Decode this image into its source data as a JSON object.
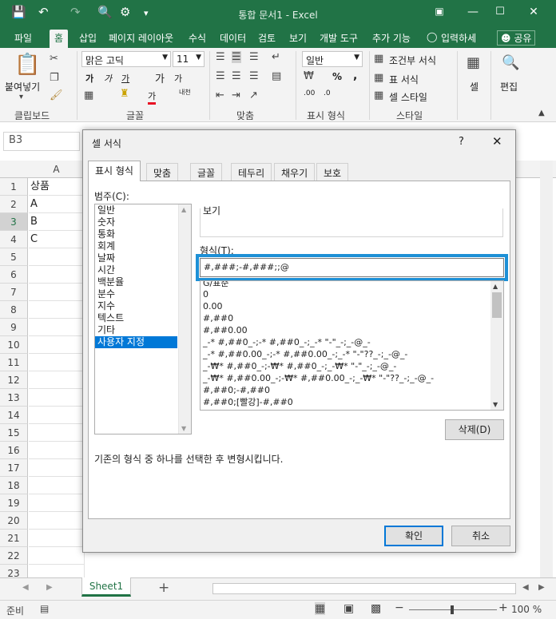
{
  "window": {
    "title": "통합 문서1 - Excel",
    "help_icon": "?",
    "controls": [
      "restore-ribbon-icon",
      "minimize-icon",
      "maximize-icon",
      "close-icon"
    ]
  },
  "quick_access": [
    "save-icon",
    "undo-icon",
    "redo-icon",
    "print-preview-icon",
    "camera-icon",
    "customize-icon"
  ],
  "ribbon": {
    "tabs": [
      "파일",
      "홈",
      "삽입",
      "페이지 레이아웃",
      "수식",
      "데이터",
      "검토",
      "보기",
      "개발 도구",
      "추가 기능"
    ],
    "active_tab": "홈",
    "tell_me": "입력하세",
    "share": "공유",
    "groups": {
      "clipboard": {
        "label": "클립보드",
        "paste": "붙여넣기"
      },
      "font": {
        "label": "글꼴",
        "font_name": "맑은 고딕",
        "font_size": "11",
        "bold": "가",
        "italic": "가",
        "underline": "가",
        "grow": "가",
        "shrink": "가",
        "phonetic": "내천",
        "font_color_glyph": "가"
      },
      "alignment": {
        "label": "맞춤"
      },
      "number": {
        "label": "표시 형식",
        "format": "일반",
        "percent": "%",
        "comma": ",",
        "inc_decimal": ".00",
        "dec_decimal": ".0"
      },
      "styles": {
        "label": "스타일",
        "conditional": "조건부 서식",
        "table": "표 서식",
        "cell_styles": "셀 스타일"
      },
      "cells": {
        "label": "셀"
      },
      "editing": {
        "label": "편집"
      }
    }
  },
  "namebox": "B3",
  "grid": {
    "col_header": "A",
    "rows": [
      "1",
      "2",
      "3",
      "4",
      "5",
      "6",
      "7",
      "8",
      "9",
      "10",
      "11",
      "12",
      "13",
      "14",
      "15",
      "16",
      "17",
      "18",
      "19",
      "20",
      "21",
      "22",
      "23"
    ],
    "selected_row": "3",
    "cells_a": [
      "상품",
      "A",
      "B",
      "C"
    ]
  },
  "sheet": {
    "tab": "Sheet1",
    "add": "+"
  },
  "status": {
    "ready": "준비",
    "zoom": "100 %"
  },
  "dialog": {
    "title": "셀 서식",
    "help": "?",
    "close": "✕",
    "tabs": [
      "표시 형식",
      "맞춤",
      "글꼴",
      "테두리",
      "채우기",
      "보호"
    ],
    "active_tab": "표시 형식",
    "category_label": "범주(C):",
    "categories": [
      "일반",
      "숫자",
      "통화",
      "회계",
      "날짜",
      "시간",
      "백분율",
      "분수",
      "지수",
      "텍스트",
      "기타",
      "사용자 지정"
    ],
    "selected_category": "사용자 지정",
    "sample_label": "보기",
    "type_label": "형식(T):",
    "type_value": "#,###;-#,###;;@",
    "formats": [
      "G/표준",
      "0",
      "0.00",
      "#,##0",
      "#,##0.00",
      "_-* #,##0_-;-* #,##0_-;_-* \"-\"_-;_-@_-",
      "_-* #,##0.00_-;-* #,##0.00_-;_-* \"-\"??_-;_-@_-",
      "_-₩* #,##0_-;-₩* #,##0_-;_-₩* \"-\"_-;_-@_-",
      "_-₩* #,##0.00_-;-₩* #,##0.00_-;_-₩* \"-\"??_-;_-@_-",
      "#,##0;-#,##0",
      "#,##0;[빨강]-#,##0"
    ],
    "delete_btn": "삭제(D)",
    "description": "기존의 형식 중 하나를 선택한 후 변형시킵니다.",
    "ok_btn": "확인",
    "cancel_btn": "취소"
  },
  "colors": {
    "accent": "#217346",
    "highlight": "#1e90d6",
    "selection": "#0078d7"
  }
}
